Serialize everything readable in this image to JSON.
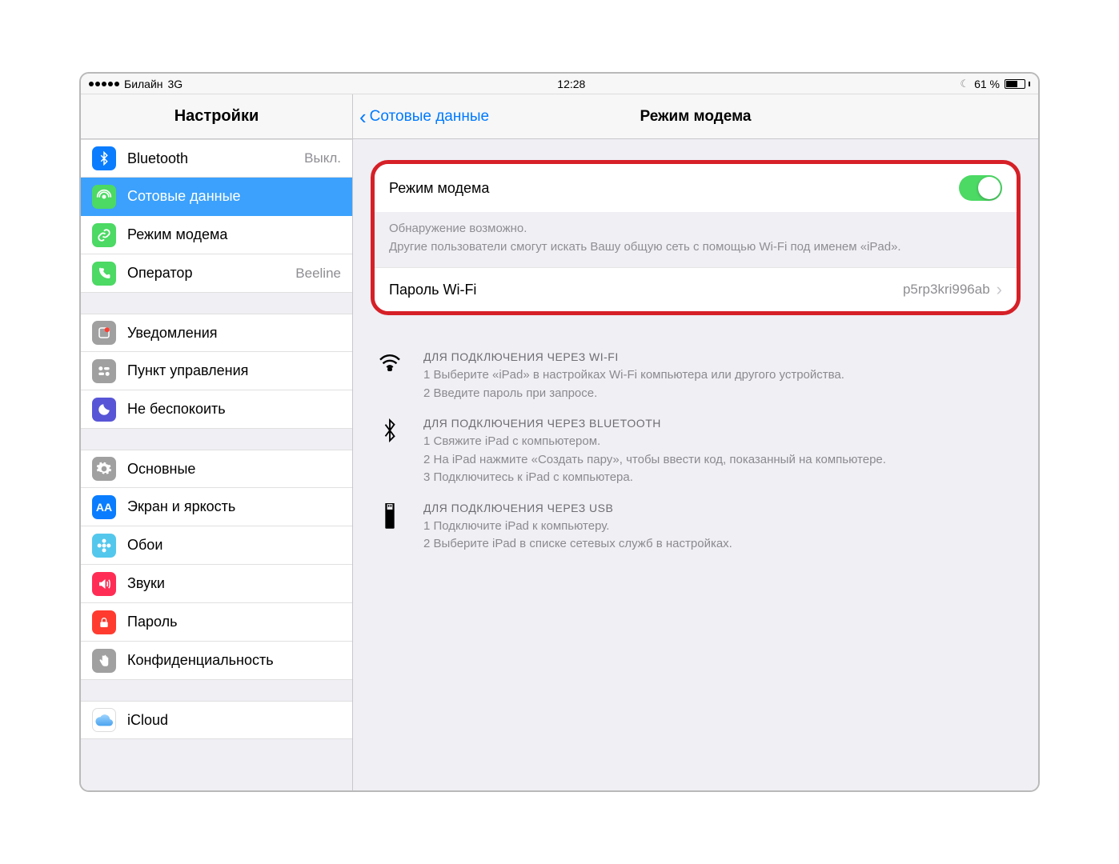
{
  "status": {
    "carrier": "Билайн",
    "network": "3G",
    "time": "12:28",
    "battery_pct": "61 %"
  },
  "left": {
    "title": "Настройки",
    "groups": [
      [
        {
          "label": "Bluetooth",
          "value": "Выкл.",
          "icon": "bluetooth",
          "color": "#0a7dff"
        },
        {
          "label": "Сотовые данные",
          "value": "",
          "icon": "antenna",
          "color": "#4cd964",
          "selected": true
        },
        {
          "label": "Режим модема",
          "value": "",
          "icon": "link",
          "color": "#4cd964"
        },
        {
          "label": "Оператор",
          "value": "Beeline",
          "icon": "phone",
          "color": "#4cd964"
        }
      ],
      [
        {
          "label": "Уведомления",
          "value": "",
          "icon": "notify",
          "color": "#a0a0a0"
        },
        {
          "label": "Пункт управления",
          "value": "",
          "icon": "control",
          "color": "#a0a0a0"
        },
        {
          "label": "Не беспокоить",
          "value": "",
          "icon": "moon",
          "color": "#5856d6"
        }
      ],
      [
        {
          "label": "Основные",
          "value": "",
          "icon": "gear",
          "color": "#a0a0a0"
        },
        {
          "label": "Экран и яркость",
          "value": "",
          "icon": "aa",
          "color": "#0a7dff"
        },
        {
          "label": "Обои",
          "value": "",
          "icon": "flower",
          "color": "#54c7ec"
        },
        {
          "label": "Звуки",
          "value": "",
          "icon": "sound",
          "color": "#ff2d55"
        },
        {
          "label": "Пароль",
          "value": "",
          "icon": "lock",
          "color": "#ff3b30"
        },
        {
          "label": "Конфиденциальность",
          "value": "",
          "icon": "hand",
          "color": "#a0a0a0"
        }
      ],
      [
        {
          "label": "iCloud",
          "value": "",
          "icon": "cloud",
          "color": "#ffffff"
        }
      ]
    ]
  },
  "right": {
    "back": "Сотовые данные",
    "title": "Режим модема",
    "hotspot": {
      "label": "Режим модема",
      "on": true,
      "footer1": "Обнаружение возможно.",
      "footer2": "Другие пользователи смогут искать Вашу общую сеть с помощью Wi-Fi под именем «iPad».",
      "password_label": "Пароль Wi-Fi",
      "password_value": "p5rp3kri996ab"
    },
    "instructions": [
      {
        "icon": "wifi",
        "header": "ДЛЯ ПОДКЛЮЧЕНИЯ ЧЕРЕЗ WI-FI",
        "lines": [
          "1 Выберите «iPad» в настройках Wi-Fi компьютера или другого устройства.",
          "2 Введите пароль при запросе."
        ]
      },
      {
        "icon": "bluetooth",
        "header": "ДЛЯ ПОДКЛЮЧЕНИЯ ЧЕРЕЗ BLUETOOTH",
        "lines": [
          "1 Свяжите iPad с компьютером.",
          "2 На iPad нажмите «Создать пару», чтобы ввести код, показанный на компьютере.",
          "3 Подключитесь к iPad с компьютера."
        ]
      },
      {
        "icon": "usb",
        "header": "ДЛЯ ПОДКЛЮЧЕНИЯ ЧЕРЕЗ USB",
        "lines": [
          "1 Подключите iPad к компьютеру.",
          "2 Выберите iPad в списке сетевых служб в настройках."
        ]
      }
    ]
  }
}
